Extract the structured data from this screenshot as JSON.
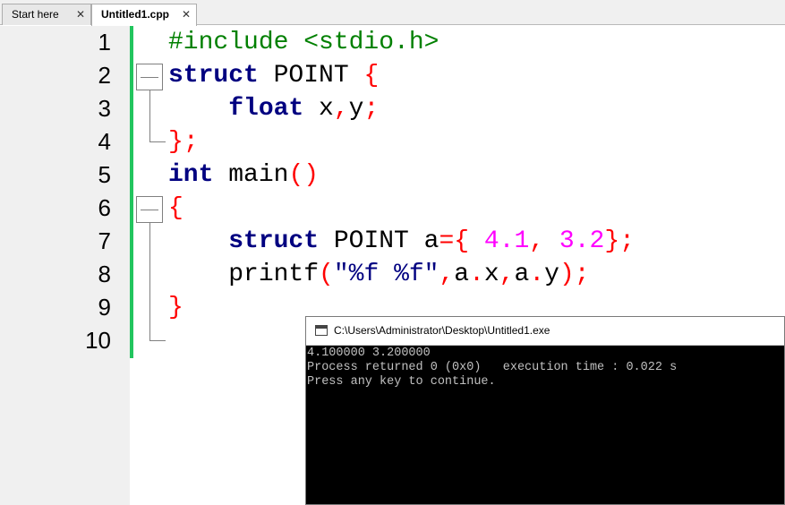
{
  "tabs": [
    {
      "label": "Start here",
      "active": false,
      "close": "✕"
    },
    {
      "label": "Untitled1.cpp",
      "active": true,
      "close": "✕"
    }
  ],
  "editor": {
    "line_numbers": [
      "1",
      "2",
      "3",
      "4",
      "5",
      "6",
      "7",
      "8",
      "9",
      "10"
    ],
    "code": {
      "l1_pp": "#include <stdio.h>",
      "l2_kw": "struct",
      "l2_name": " POINT ",
      "l2_brace": "{",
      "l3_indent": "    ",
      "l3_kw": "float",
      "l3_x": " x",
      "l3_comma": ",",
      "l3_y": "y",
      "l3_semi": ";",
      "l4_brace": "}",
      "l4_semi": ";",
      "l5_kw": "int",
      "l5_main": " main",
      "l5_parens": "()",
      "l6_brace": "{",
      "l7_indent": "    ",
      "l7_kw": "struct",
      "l7_name": " POINT a",
      "l7_eq": "={",
      "l7_n1": " 4.1",
      "l7_comma": ",",
      "l7_n2": " 3.2",
      "l7_close": "};",
      "l8_indent": "    ",
      "l8_fn": "printf",
      "l8_open": "(",
      "l8_str": "\"%f %f\"",
      "l8_c1": ",",
      "l8_ax1": "a",
      "l8_dot1": ".",
      "l8_ax2": "x",
      "l8_c2": ",",
      "l8_ay1": "a",
      "l8_dot2": ".",
      "l8_ay2": "y",
      "l8_close": ");",
      "l9_brace": "}"
    }
  },
  "console": {
    "title": "C:\\Users\\Administrator\\Desktop\\Untitled1.exe",
    "lines": [
      "4.100000 3.200000",
      "Process returned 0 (0x0)   execution time : 0.022 s",
      "Press any key to continue."
    ]
  }
}
